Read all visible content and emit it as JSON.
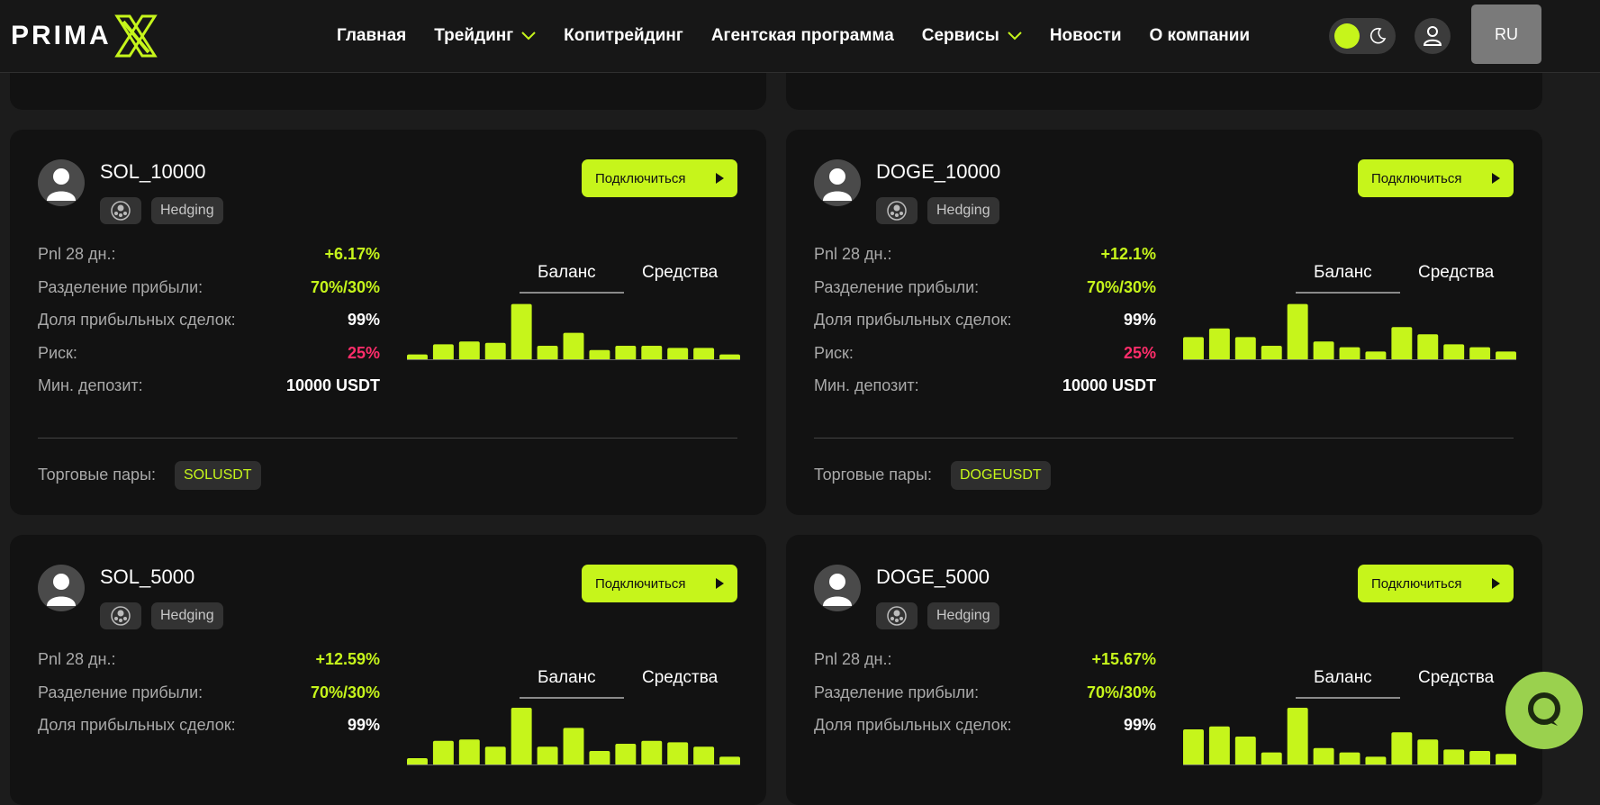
{
  "header": {
    "logo_text": "PRIMA",
    "nav": [
      {
        "label": "Главная",
        "dropdown": false
      },
      {
        "label": "Трейдинг",
        "dropdown": true
      },
      {
        "label": "Копитрейдинг",
        "dropdown": false
      },
      {
        "label": "Агентская программа",
        "dropdown": false
      },
      {
        "label": "Сервисы",
        "dropdown": true
      },
      {
        "label": "Новости",
        "dropdown": false
      },
      {
        "label": "О компании",
        "dropdown": false
      }
    ],
    "language": "RU",
    "theme_toggle": "dark-mode",
    "accent_color": "#c6f51b"
  },
  "cards": [
    {
      "name": "SOL_10000",
      "tag": "Hedging",
      "connect_label": "Подключиться",
      "stats": [
        {
          "label": "Pnl 28 дн.:",
          "value": "+6.17%",
          "color": "green"
        },
        {
          "label": "Разделение прибыли:",
          "value": "70%/30%",
          "color": "green"
        },
        {
          "label": "Доля прибыльных сделок:",
          "value": "99%",
          "color": "white"
        },
        {
          "label": "Риск:",
          "value": "25%",
          "color": "red"
        },
        {
          "label": "Мин. депозит:",
          "value": "10000 USDT",
          "color": "white"
        }
      ],
      "tabs": [
        "Баланс",
        "Средства"
      ],
      "active_tab": "Баланс",
      "bars": [
        8,
        22,
        26,
        24,
        78,
        20,
        38,
        14,
        20,
        20,
        17,
        17,
        8
      ],
      "pairs_label": "Торговые пары:",
      "pair": "SOLUSDT"
    },
    {
      "name": "DOGE_10000",
      "tag": "Hedging",
      "connect_label": "Подключиться",
      "stats": [
        {
          "label": "Pnl 28 дн.:",
          "value": "+12.1%",
          "color": "green"
        },
        {
          "label": "Разделение прибыли:",
          "value": "70%/30%",
          "color": "green"
        },
        {
          "label": "Доля прибыльных сделок:",
          "value": "99%",
          "color": "white"
        },
        {
          "label": "Риск:",
          "value": "25%",
          "color": "red"
        },
        {
          "label": "Мин. депозит:",
          "value": "10000 USDT",
          "color": "white"
        }
      ],
      "tabs": [
        "Баланс",
        "Средства"
      ],
      "active_tab": "Баланс",
      "bars": [
        32,
        44,
        32,
        20,
        78,
        26,
        18,
        12,
        46,
        36,
        22,
        18,
        12
      ],
      "pairs_label": "Торговые пары:",
      "pair": "DOGEUSDT"
    },
    {
      "name": "SOL_5000",
      "tag": "Hedging",
      "connect_label": "Подключиться",
      "stats": [
        {
          "label": "Pnl 28 дн.:",
          "value": "+12.59%",
          "color": "green"
        },
        {
          "label": "Разделение прибыли:",
          "value": "70%/30%",
          "color": "green"
        },
        {
          "label": "Доля прибыльных сделок:",
          "value": "99%",
          "color": "white"
        }
      ],
      "tabs": [
        "Баланс",
        "Средства"
      ],
      "active_tab": "Баланс",
      "bars": [
        10,
        34,
        36,
        26,
        80,
        26,
        52,
        20,
        30,
        34,
        32,
        26,
        12
      ]
    },
    {
      "name": "DOGE_5000",
      "tag": "Hedging",
      "connect_label": "Подключиться",
      "stats": [
        {
          "label": "Pnl 28 дн.:",
          "value": "+15.67%",
          "color": "green"
        },
        {
          "label": "Разделение прибыли:",
          "value": "70%/30%",
          "color": "green"
        },
        {
          "label": "Доля прибыльных сделок:",
          "value": "99%",
          "color": "white"
        }
      ],
      "tabs": [
        "Баланс",
        "Средства"
      ],
      "active_tab": "Баланс",
      "bars": [
        50,
        54,
        40,
        18,
        80,
        24,
        18,
        12,
        46,
        36,
        22,
        20,
        16
      ]
    }
  ]
}
